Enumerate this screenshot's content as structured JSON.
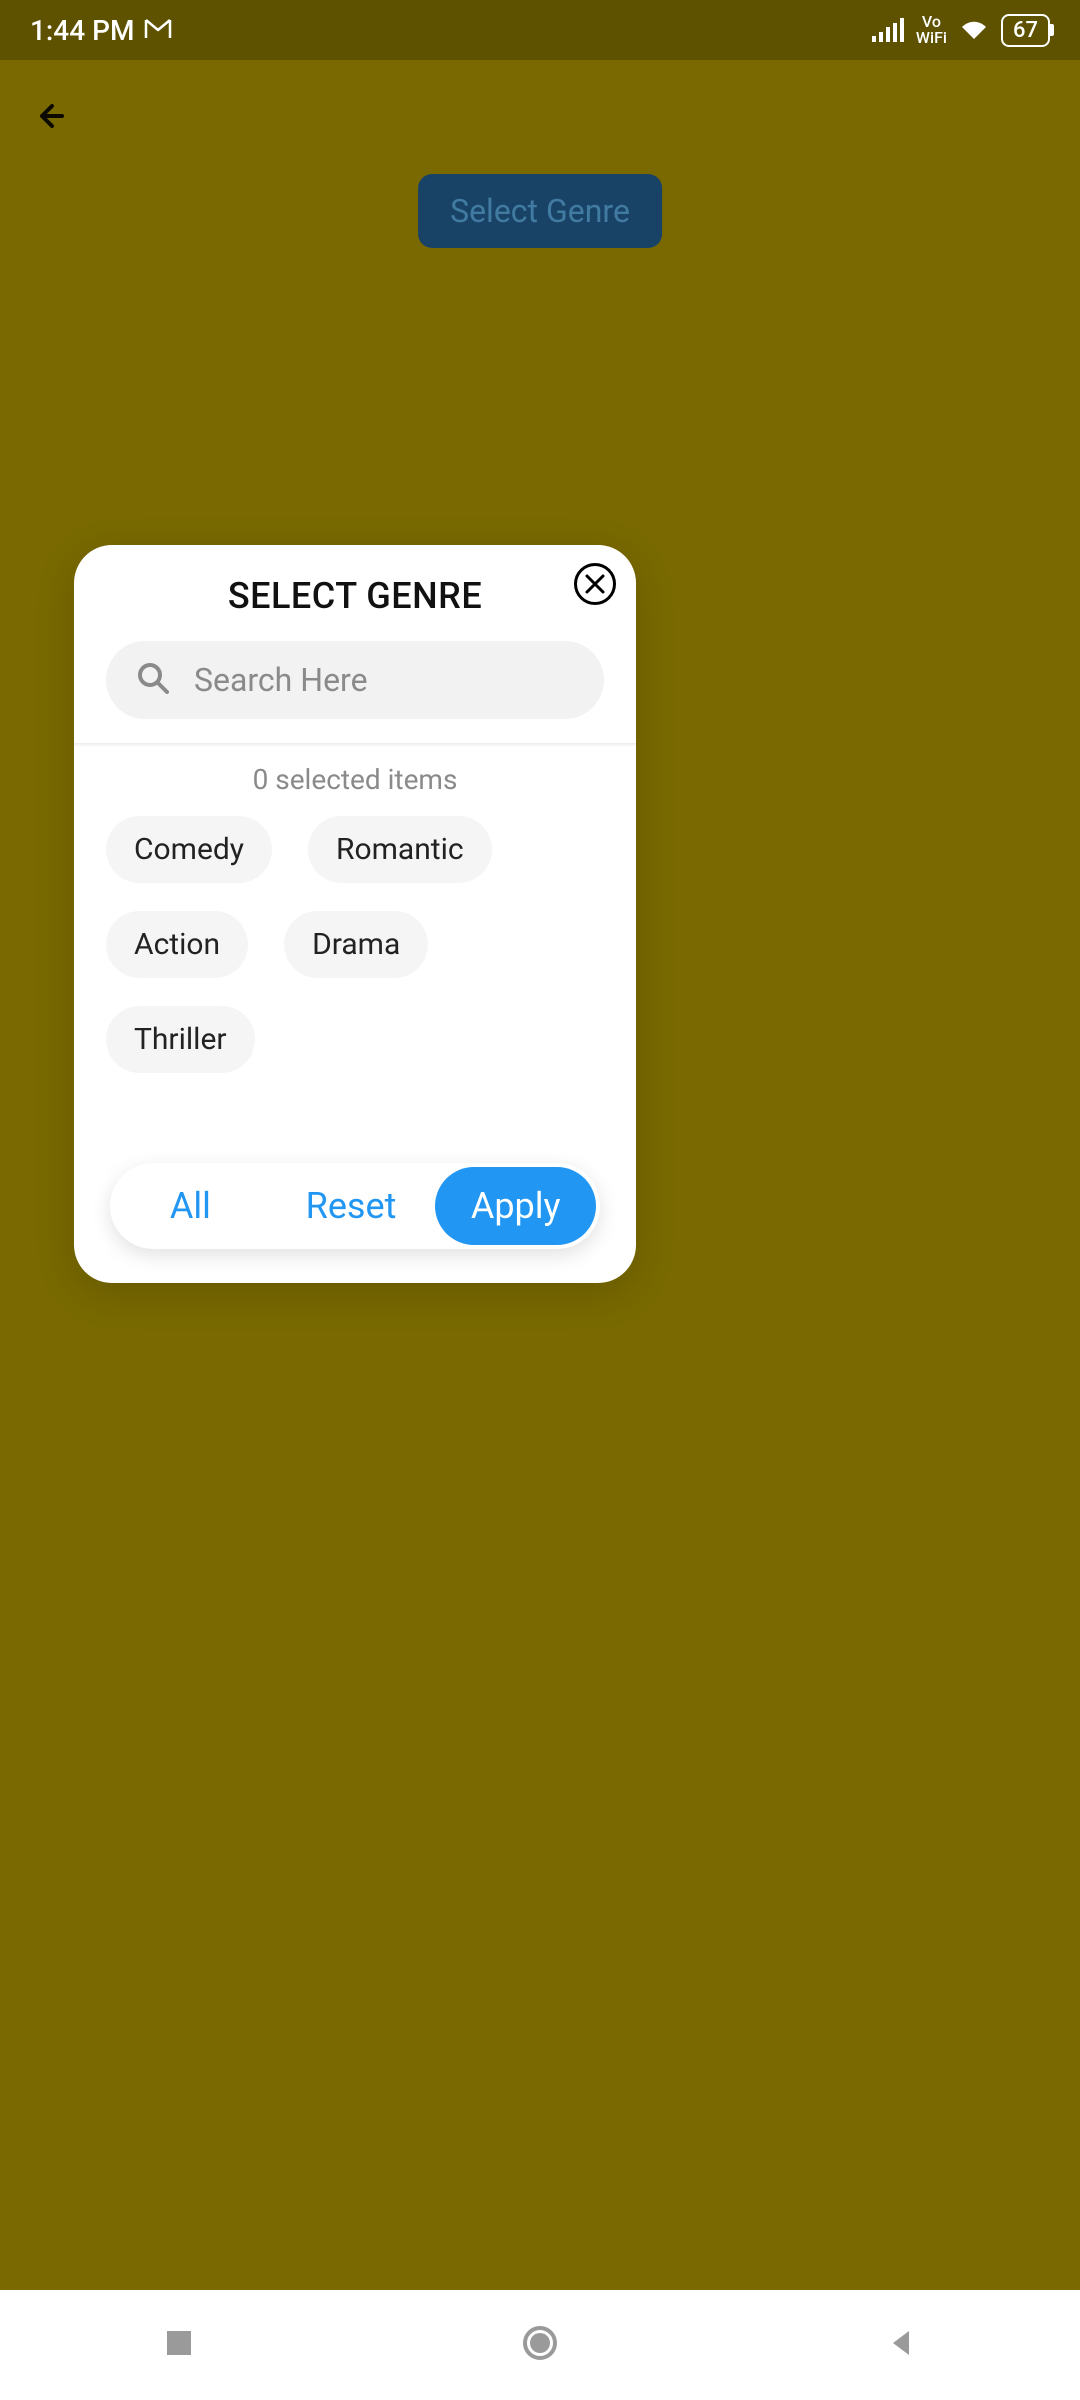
{
  "status": {
    "time": "1:44 PM",
    "vowifi_line1": "Vo",
    "vowifi_line2": "WiFi",
    "battery": "67"
  },
  "main": {
    "select_genre_btn": "Select Genre"
  },
  "dialog": {
    "title": "SELECT GENRE",
    "search_placeholder": "Search Here",
    "selected_count": "0 selected items",
    "genres": [
      "Comedy",
      "Romantic",
      "Action",
      "Drama",
      "Thriller"
    ],
    "actions": {
      "all": "All",
      "reset": "Reset",
      "apply": "Apply"
    }
  }
}
